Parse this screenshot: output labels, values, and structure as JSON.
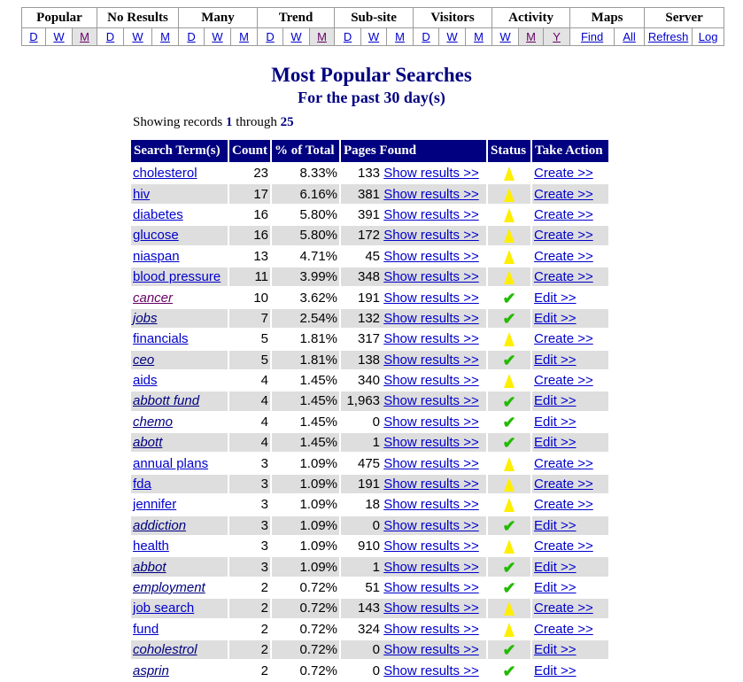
{
  "nav": {
    "groups": [
      "Popular",
      "No Results",
      "Many",
      "Trend",
      "Sub-site",
      "Visitors",
      "Activity",
      "Maps",
      "Server"
    ],
    "links": [
      {
        "label": "D"
      },
      {
        "label": "W"
      },
      {
        "label": "M"
      },
      {
        "label": "D"
      },
      {
        "label": "W"
      },
      {
        "label": "M"
      },
      {
        "label": "D"
      },
      {
        "label": "W"
      },
      {
        "label": "M"
      },
      {
        "label": "D"
      },
      {
        "label": "W"
      },
      {
        "label": "M"
      },
      {
        "label": "D"
      },
      {
        "label": "W"
      },
      {
        "label": "M"
      },
      {
        "label": "D"
      },
      {
        "label": "W"
      },
      {
        "label": "M"
      },
      {
        "label": "W"
      },
      {
        "label": "M"
      },
      {
        "label": "Y"
      },
      {
        "label": "Find"
      },
      {
        "label": "All"
      },
      {
        "label": "Refresh"
      },
      {
        "label": "Log"
      }
    ]
  },
  "heading": {
    "title": "Most Popular Searches",
    "subtitle": "For the past 30 day(s)"
  },
  "showing": {
    "prefix": "Showing records ",
    "from": "1",
    "middle": " through ",
    "to": "25"
  },
  "table": {
    "headers": {
      "term": "Search Term(s)",
      "count": "Count",
      "pct": "% of Total",
      "pages": "Pages Found",
      "status": "Status",
      "action": "Take Action"
    },
    "show_label": "Show results >>",
    "rows": [
      {
        "term": "cholesterol",
        "count": "23",
        "pct": "8.33%",
        "pages": "133",
        "status": "warning",
        "action": "Create >>",
        "italic": false
      },
      {
        "term": "hiv",
        "count": "17",
        "pct": "6.16%",
        "pages": "381",
        "status": "warning",
        "action": "Create >>",
        "italic": false
      },
      {
        "term": "diabetes",
        "count": "16",
        "pct": "5.80%",
        "pages": "391",
        "status": "warning",
        "action": "Create >>",
        "italic": false
      },
      {
        "term": "glucose",
        "count": "16",
        "pct": "5.80%",
        "pages": "172",
        "status": "warning",
        "action": "Create >>",
        "italic": false
      },
      {
        "term": "niaspan",
        "count": "13",
        "pct": "4.71%",
        "pages": "45",
        "status": "warning",
        "action": "Create >>",
        "italic": false
      },
      {
        "term": "blood pressure",
        "count": "11",
        "pct": "3.99%",
        "pages": "348",
        "status": "warning",
        "action": "Create >>",
        "italic": false
      },
      {
        "term": "cancer",
        "count": "10",
        "pct": "3.62%",
        "pages": "191",
        "status": "ok",
        "action": "Edit >>",
        "italic": true
      },
      {
        "term": "jobs",
        "count": "7",
        "pct": "2.54%",
        "pages": "132",
        "status": "ok",
        "action": "Edit >>",
        "italic": true
      },
      {
        "term": "financials",
        "count": "5",
        "pct": "1.81%",
        "pages": "317",
        "status": "warning",
        "action": "Create >>",
        "italic": false
      },
      {
        "term": "ceo",
        "count": "5",
        "pct": "1.81%",
        "pages": "138",
        "status": "ok",
        "action": "Edit >>",
        "italic": true
      },
      {
        "term": "aids",
        "count": "4",
        "pct": "1.45%",
        "pages": "340",
        "status": "warning",
        "action": "Create >>",
        "italic": false
      },
      {
        "term": "abbott fund",
        "count": "4",
        "pct": "1.45%",
        "pages": "1,963",
        "status": "ok",
        "action": "Edit >>",
        "italic": true
      },
      {
        "term": "chemo",
        "count": "4",
        "pct": "1.45%",
        "pages": "0",
        "status": "ok",
        "action": "Edit >>",
        "italic": true
      },
      {
        "term": "abott",
        "count": "4",
        "pct": "1.45%",
        "pages": "1",
        "status": "ok",
        "action": "Edit >>",
        "italic": true
      },
      {
        "term": "annual plans",
        "count": "3",
        "pct": "1.09%",
        "pages": "475",
        "status": "warning",
        "action": "Create >>",
        "italic": false
      },
      {
        "term": "fda",
        "count": "3",
        "pct": "1.09%",
        "pages": "191",
        "status": "warning",
        "action": "Create >>",
        "italic": false
      },
      {
        "term": "jennifer",
        "count": "3",
        "pct": "1.09%",
        "pages": "18",
        "status": "warning",
        "action": "Create >>",
        "italic": false
      },
      {
        "term": "addiction",
        "count": "3",
        "pct": "1.09%",
        "pages": "0",
        "status": "ok",
        "action": "Edit >>",
        "italic": true
      },
      {
        "term": "health",
        "count": "3",
        "pct": "1.09%",
        "pages": "910",
        "status": "warning",
        "action": "Create >>",
        "italic": false
      },
      {
        "term": "abbot",
        "count": "3",
        "pct": "1.09%",
        "pages": "1",
        "status": "ok",
        "action": "Edit >>",
        "italic": true
      },
      {
        "term": "employment",
        "count": "2",
        "pct": "0.72%",
        "pages": "51",
        "status": "ok",
        "action": "Edit >>",
        "italic": true
      },
      {
        "term": "job search",
        "count": "2",
        "pct": "0.72%",
        "pages": "143",
        "status": "warning",
        "action": "Create >>",
        "italic": false
      },
      {
        "term": "fund",
        "count": "2",
        "pct": "0.72%",
        "pages": "324",
        "status": "warning",
        "action": "Create >>",
        "italic": false
      },
      {
        "term": "coholestrol",
        "count": "2",
        "pct": "0.72%",
        "pages": "0",
        "status": "ok",
        "action": "Edit >>",
        "italic": true
      },
      {
        "term": "asprin",
        "count": "2",
        "pct": "0.72%",
        "pages": "0",
        "status": "ok",
        "action": "Edit >>",
        "italic": true
      }
    ]
  },
  "icons": {
    "warning": "warning-triangle-icon",
    "ok": "checkmark-icon"
  },
  "colors": {
    "header_bg": "#000080",
    "heading_text": "#000080",
    "link": "#0000cc",
    "row_alt": "#dedede",
    "warning": "#ffee00",
    "ok": "#22bb00"
  }
}
